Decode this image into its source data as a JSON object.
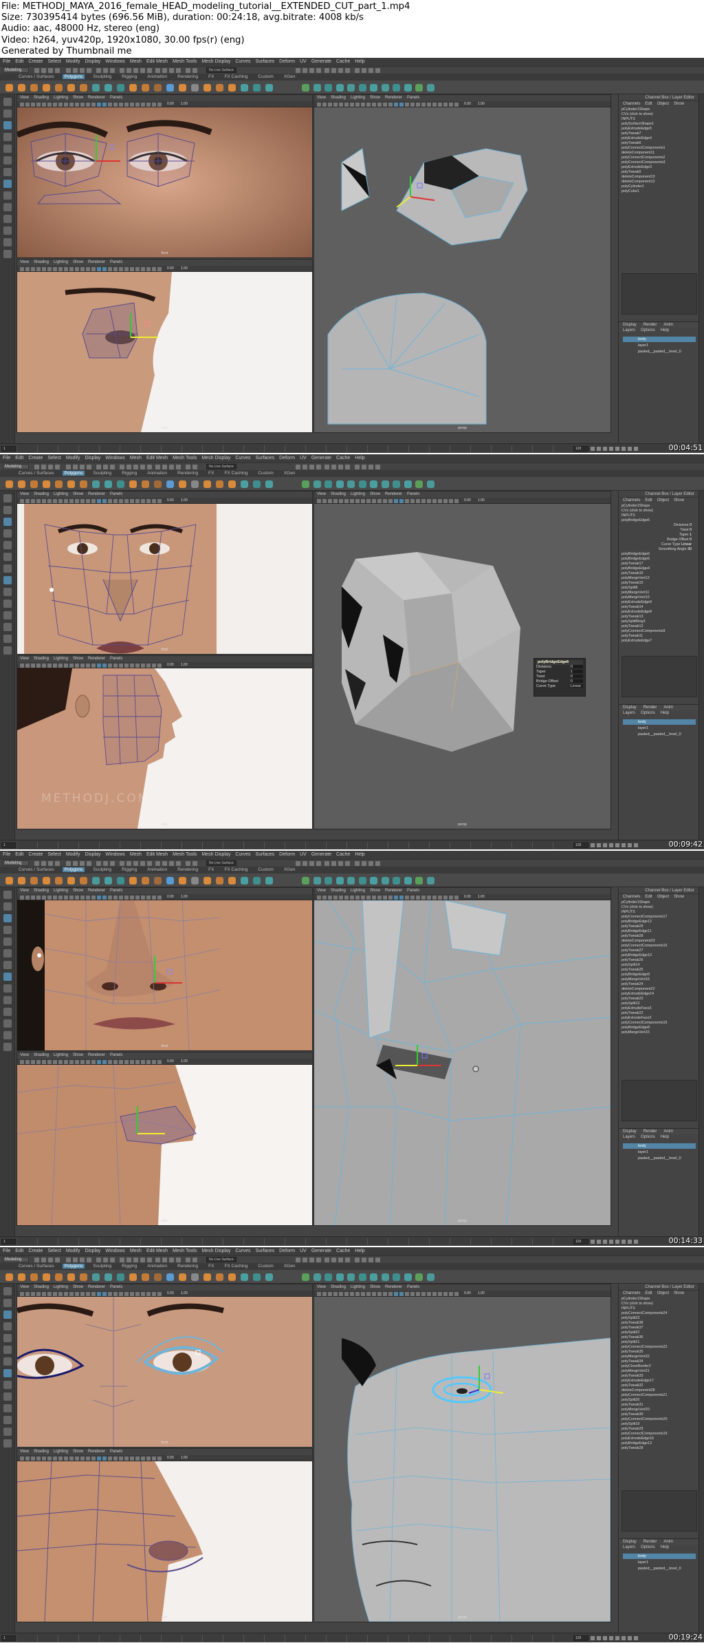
{
  "file_info": {
    "line1": "File: METHODJ_MAYA_2016_female_HEAD_modeling_tutorial__EXTENDED_CUT_part_1.mp4",
    "line2": "Size: 730395414 bytes (696.56 MiB), duration: 00:24:18, avg.bitrate: 4008 kb/s",
    "line3": "Audio: aac, 48000 Hz, stereo (eng)",
    "line4": "Video: h264, yuv420p, 1920x1080, 30.00 fps(r) (eng)",
    "line5": "Generated by Thumbnail me"
  },
  "maya": {
    "menus": [
      "File",
      "Edit",
      "Create",
      "Select",
      "Modify",
      "Display",
      "Windows",
      "Mesh",
      "Edit Mesh",
      "Mesh Tools",
      "Mesh Display",
      "Curves",
      "Surfaces",
      "Deform",
      "UV",
      "Generate",
      "Cache",
      "Help"
    ],
    "workspace_mode": "Modeling",
    "live_surface": "No Live Surface",
    "shelf_tabs": [
      "Curves / Surfaces",
      "Polygons",
      "Sculpting",
      "Rigging",
      "Animation",
      "Rendering",
      "FX",
      "FX Caching",
      "Custom",
      "XGen"
    ],
    "active_shelf_tab": "Polygons",
    "panel_menus": [
      "View",
      "Shading",
      "Lighting",
      "Show",
      "Renderer",
      "Panels"
    ],
    "channel_box_title": "Channel Box / Layer Editor",
    "channel_menus": [
      "Channels",
      "Edit",
      "Object",
      "Show"
    ],
    "layer_tabs": [
      "Display",
      "Render",
      "Anim"
    ],
    "layer_menus": [
      "Layers",
      "Options",
      "Help"
    ],
    "layers": [
      "body",
      "layer1",
      "pasted__pasted__level_0"
    ],
    "camera_front": "front",
    "camera_side": "side",
    "camera_persp": "persp",
    "exposure": "0.00",
    "gamma": "1.00",
    "timeline_end": "120",
    "timeline_current": "1"
  },
  "frames": [
    {
      "timestamp": "00:04:51",
      "nodes": [
        "polySurfaceShape1",
        "polyExtrudeEdge5",
        "polyTweak7",
        "polyExtrudeEdge4",
        "polyTweak6",
        "polyConnectComponents1",
        "deleteComponent11",
        "polyConnectComponents2",
        "polyConnectComponents3",
        "polyExtrudeEdge3",
        "polyTweak5",
        "deleteComponent13",
        "deleteComponent12",
        "polyCylinder1",
        "polyCube1"
      ],
      "header_lines": [
        "pCylinder1Shape",
        "CVs (click to show)",
        "INPUTS"
      ]
    },
    {
      "timestamp": "00:09:42",
      "nodes": [
        "polyBridgeEdge6",
        "polyBridgeEdge5",
        "polyTweak17",
        "polyBridgeEdge4",
        "polyTweak16",
        "polyMergeVert12",
        "polyTweak15",
        "polySplit8",
        "polyMergeVert11",
        "polyMergeVert10",
        "polyExtrudeEdge9",
        "polyTweak14",
        "polyExtrudeEdge8",
        "polyTweak13",
        "polySplitRing3",
        "polyTweak12",
        "polyConnectComponents9",
        "polyTweak11",
        "polyExtrudeEdge7"
      ],
      "header_lines": [
        "pCylinder1Shape",
        "CVs (click to show)",
        "INPUTS",
        "polyBridgeEdge6"
      ],
      "attributes": [
        [
          "Divisions",
          "0"
        ],
        [
          "Twist",
          "0"
        ],
        [
          "Taper",
          "1"
        ],
        [
          "Bridge Offset",
          "0"
        ],
        [
          "Curve Type",
          "Linear"
        ],
        [
          "Smoothing Angle",
          "30"
        ]
      ],
      "overlay_title": "polyBridgeEdge6",
      "overlay_rows": [
        [
          "Divisions",
          "0"
        ],
        [
          "Taper",
          "1"
        ],
        [
          "Twist",
          "0"
        ],
        [
          "Bridge Offset",
          "0"
        ],
        [
          "Curve Type",
          "Linear"
        ]
      ],
      "watermark": "METHODJ.COM"
    },
    {
      "timestamp": "00:14:33",
      "nodes": [
        "polyConnectComponents17",
        "polyBridgeEdge12",
        "polyTweak29",
        "polyBridgeEdge11",
        "polyTweak28",
        "deleteComponent23",
        "polyConnectComponents16",
        "polyTweak27",
        "polyBridgeEdge10",
        "polyTweak26",
        "polySplit14",
        "polyTweak25",
        "polyBridgeEdge9",
        "polyMergeVert16",
        "polyTweak24",
        "deleteComponent22",
        "polyExtrudeEdge14",
        "polyTweak23",
        "polySplit13",
        "polyExtrudeFace3",
        "polyTweak22",
        "polyExtrudeFace2",
        "polyConnectComponents15",
        "polyBridgeEdge8",
        "polyMergeVert15"
      ],
      "header_lines": [
        "pCylinder1Shape",
        "CVs (click to show)",
        "INPUTS"
      ]
    },
    {
      "timestamp": "00:19:24",
      "nodes": [
        "polyConnectComponents24",
        "polySplit23",
        "polyTweak38",
        "polyTweak37",
        "polySplit22",
        "polyTweak36",
        "polySplit21",
        "polyConnectComponents22",
        "polyTweak35",
        "polyMergeVert22",
        "polyTweak34",
        "polyCloseBorder2",
        "polyMergeVert21",
        "polyTweak33",
        "polyExtrudeEdge17",
        "polyTweak32",
        "deleteComponent28",
        "polyConnectComponents21",
        "polySplit20",
        "polyTweak31",
        "polyMergeVert20",
        "polyTweak30",
        "polyConnectComponents20",
        "polySplit19",
        "polyTweak29",
        "polyConnectComponents19",
        "polyExtrudeEdge16",
        "polyBridgeEdge13",
        "polyTweak28"
      ],
      "header_lines": [
        "pCylinder1Shape",
        "CVs (click to show)",
        "INPUTS"
      ]
    }
  ],
  "colors": {
    "maya_bg": "#444444",
    "viewport_grey": "#5a5a5a",
    "selection_blue": "#5285a6",
    "wire_blue": "#6fb4d8",
    "wire_purple": "#5b4a8c",
    "skin": "#c89a78"
  }
}
